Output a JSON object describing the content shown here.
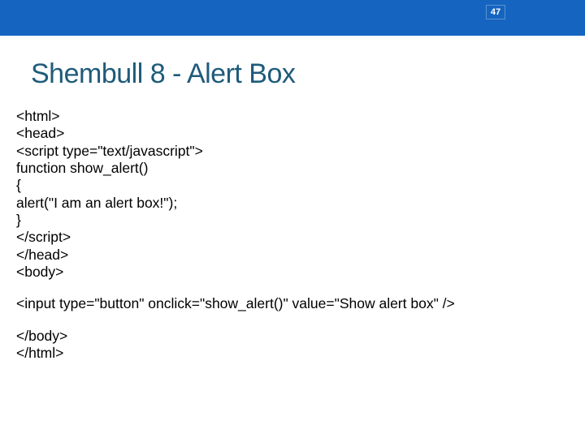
{
  "page_number": "47",
  "title": "Shembull 8 - Alert Box",
  "code": {
    "l1": "<html>",
    "l2": "<head>",
    "l3": "<script type=\"text/javascript\">",
    "l4": "function show_alert()",
    "l5": "{",
    "l6": "alert(\"I am an alert box!\");",
    "l7": "}",
    "l8": "</script>",
    "l9": "</head>",
    "l10": "<body>",
    "l11": "<input type=\"button\" onclick=\"show_alert()\" value=\"Show alert box\" />",
    "l12": "</body>",
    "l13": "</html>"
  }
}
